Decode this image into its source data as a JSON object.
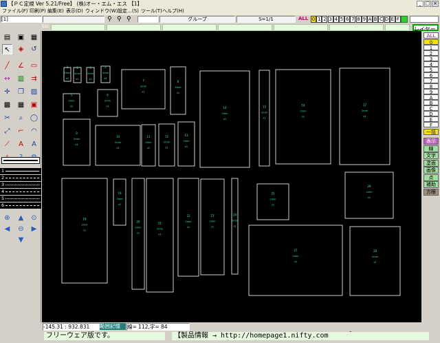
{
  "window": {
    "title": "【ＰＣ定規 Ver 5.21/Free】 (株)オー・エム・エス  【1】",
    "min": "_",
    "max": "□",
    "close": "×"
  },
  "menu": [
    "ファイル(F)",
    "印刷(P)",
    "編集(E)",
    "表示(D)",
    "ウィンドウ(W)",
    "設定…(S)",
    "ツール(T)",
    "ヘルプ(H)"
  ],
  "toolbar": {
    "file_field": "[1]",
    "group_label": "グループ",
    "scale": "S=1/1",
    "all_label": "ALL",
    "layers": [
      "0",
      "1",
      "2",
      "3",
      "4",
      "5",
      "6",
      "7",
      "8",
      "9",
      "A",
      "B",
      "C",
      "D",
      "E",
      "F"
    ],
    "esc": "Esc"
  },
  "right_panel": {
    "title": "レイヤー",
    "all": "ALL",
    "layers": [
      "0",
      "1",
      "2",
      "3",
      "4",
      "5",
      "6",
      "7",
      "8",
      "9",
      "A",
      "B",
      "C",
      "D",
      "E",
      "F"
    ],
    "ikkatsu": "一括",
    "modes": [
      "表示",
      "線",
      "文字",
      "塗面",
      "画像",
      "点",
      "補助",
      "方眼"
    ]
  },
  "line_styles": [
    "1",
    "2",
    "3",
    "4",
    "5",
    "6"
  ],
  "status": {
    "coords": "-145.31 : 932.831",
    "range_memory": "範囲記憶",
    "line_info": "線= 112,字=  84"
  },
  "footer": {
    "freeware": "フリーウェア版です。",
    "product_info": "【製品情報 → http://homepage1.nifty.com/oms/】"
  },
  "canvas_items": [
    {
      "id": "1",
      "t": "1"
    },
    {
      "id": "2",
      "t": "2"
    },
    {
      "id": "3",
      "t": "3"
    },
    {
      "id": "4",
      "t": "4"
    },
    {
      "id": "5",
      "t": "5"
    },
    {
      "id": "6",
      "t": "6"
    },
    {
      "id": "7",
      "t": "7"
    },
    {
      "id": "8",
      "t": "8"
    },
    {
      "id": "9",
      "t": "9"
    },
    {
      "id": "10",
      "t": "10"
    },
    {
      "id": "11",
      "t": "11"
    },
    {
      "id": "12",
      "t": "12"
    },
    {
      "id": "13",
      "t": "13"
    },
    {
      "id": "14",
      "t": "14"
    },
    {
      "id": "15",
      "t": "15"
    },
    {
      "id": "16",
      "t": "16"
    },
    {
      "id": "17",
      "t": "17"
    },
    {
      "id": "18",
      "t": "18"
    },
    {
      "id": "19",
      "t": "19"
    },
    {
      "id": "20",
      "t": "20"
    },
    {
      "id": "21",
      "t": "21"
    },
    {
      "id": "22",
      "t": "22"
    },
    {
      "id": "23",
      "t": "23"
    },
    {
      "id": "24",
      "t": "24"
    },
    {
      "id": "25",
      "t": "25"
    },
    {
      "id": "26",
      "t": "26"
    },
    {
      "id": "27",
      "t": "27"
    },
    {
      "id": "28",
      "t": "28"
    },
    {
      "id": "29",
      "t": "29"
    },
    {
      "id": "30",
      "t": "30"
    }
  ],
  "canvas_sublabel": "2mm",
  "canvas_sublabel2": "x1",
  "colors": {
    "canvas_bg": "#000000",
    "rect_stroke": "#ffffff",
    "label": "#2ee8c8",
    "accent": "#f0e000",
    "layer_active": "#ffe400"
  }
}
